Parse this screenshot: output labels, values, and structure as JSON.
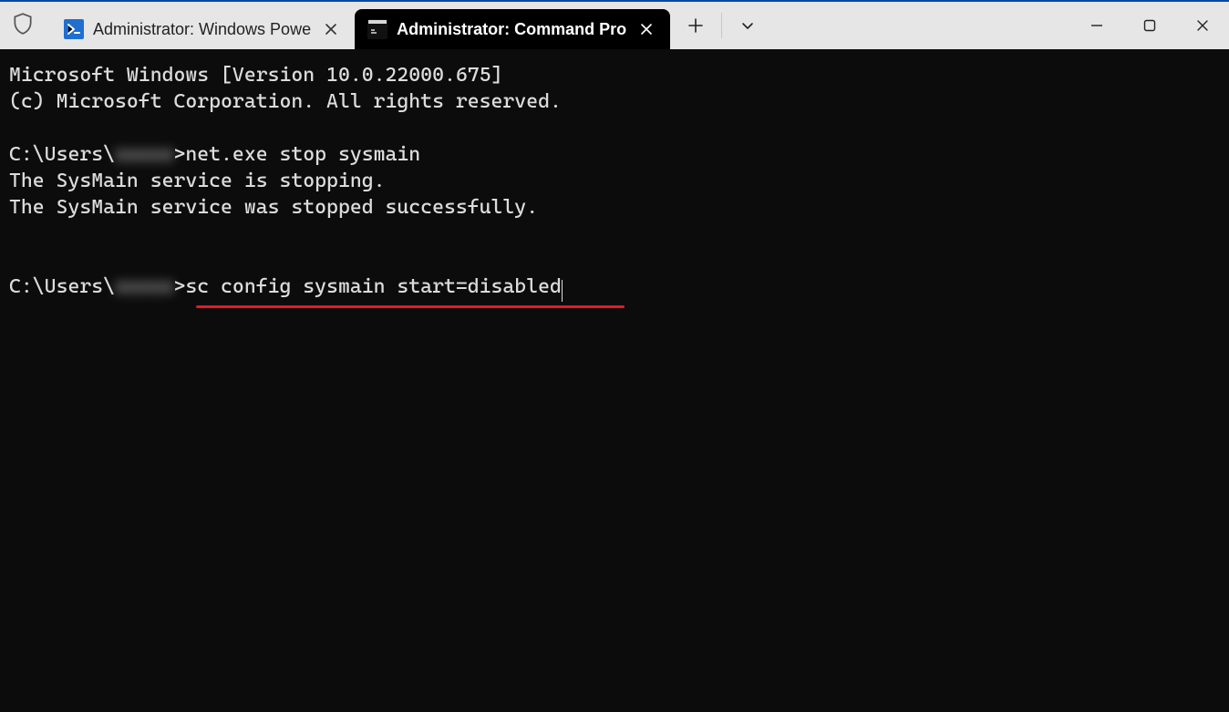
{
  "tabs": [
    {
      "label": "Administrator: Windows Powe",
      "active": false
    },
    {
      "label": "Administrator: Command Pro",
      "active": true
    }
  ],
  "terminal": {
    "banner_line1": "Microsoft Windows [Version 10.0.22000.675]",
    "banner_line2": "(c) Microsoft Corporation. All rights reserved.",
    "prompt_prefix": "C:\\Users\\",
    "prompt_blur": "xxxxx",
    "prompt_gt": ">",
    "cmd1": "net.exe stop sysmain",
    "out1_line1": "The SysMain service is stopping.",
    "out1_line2": "The SysMain service was stopped successfully.",
    "cmd2": "sc config sysmain start=disabled"
  },
  "annotation": {
    "underline_color": "#e11b2a"
  }
}
